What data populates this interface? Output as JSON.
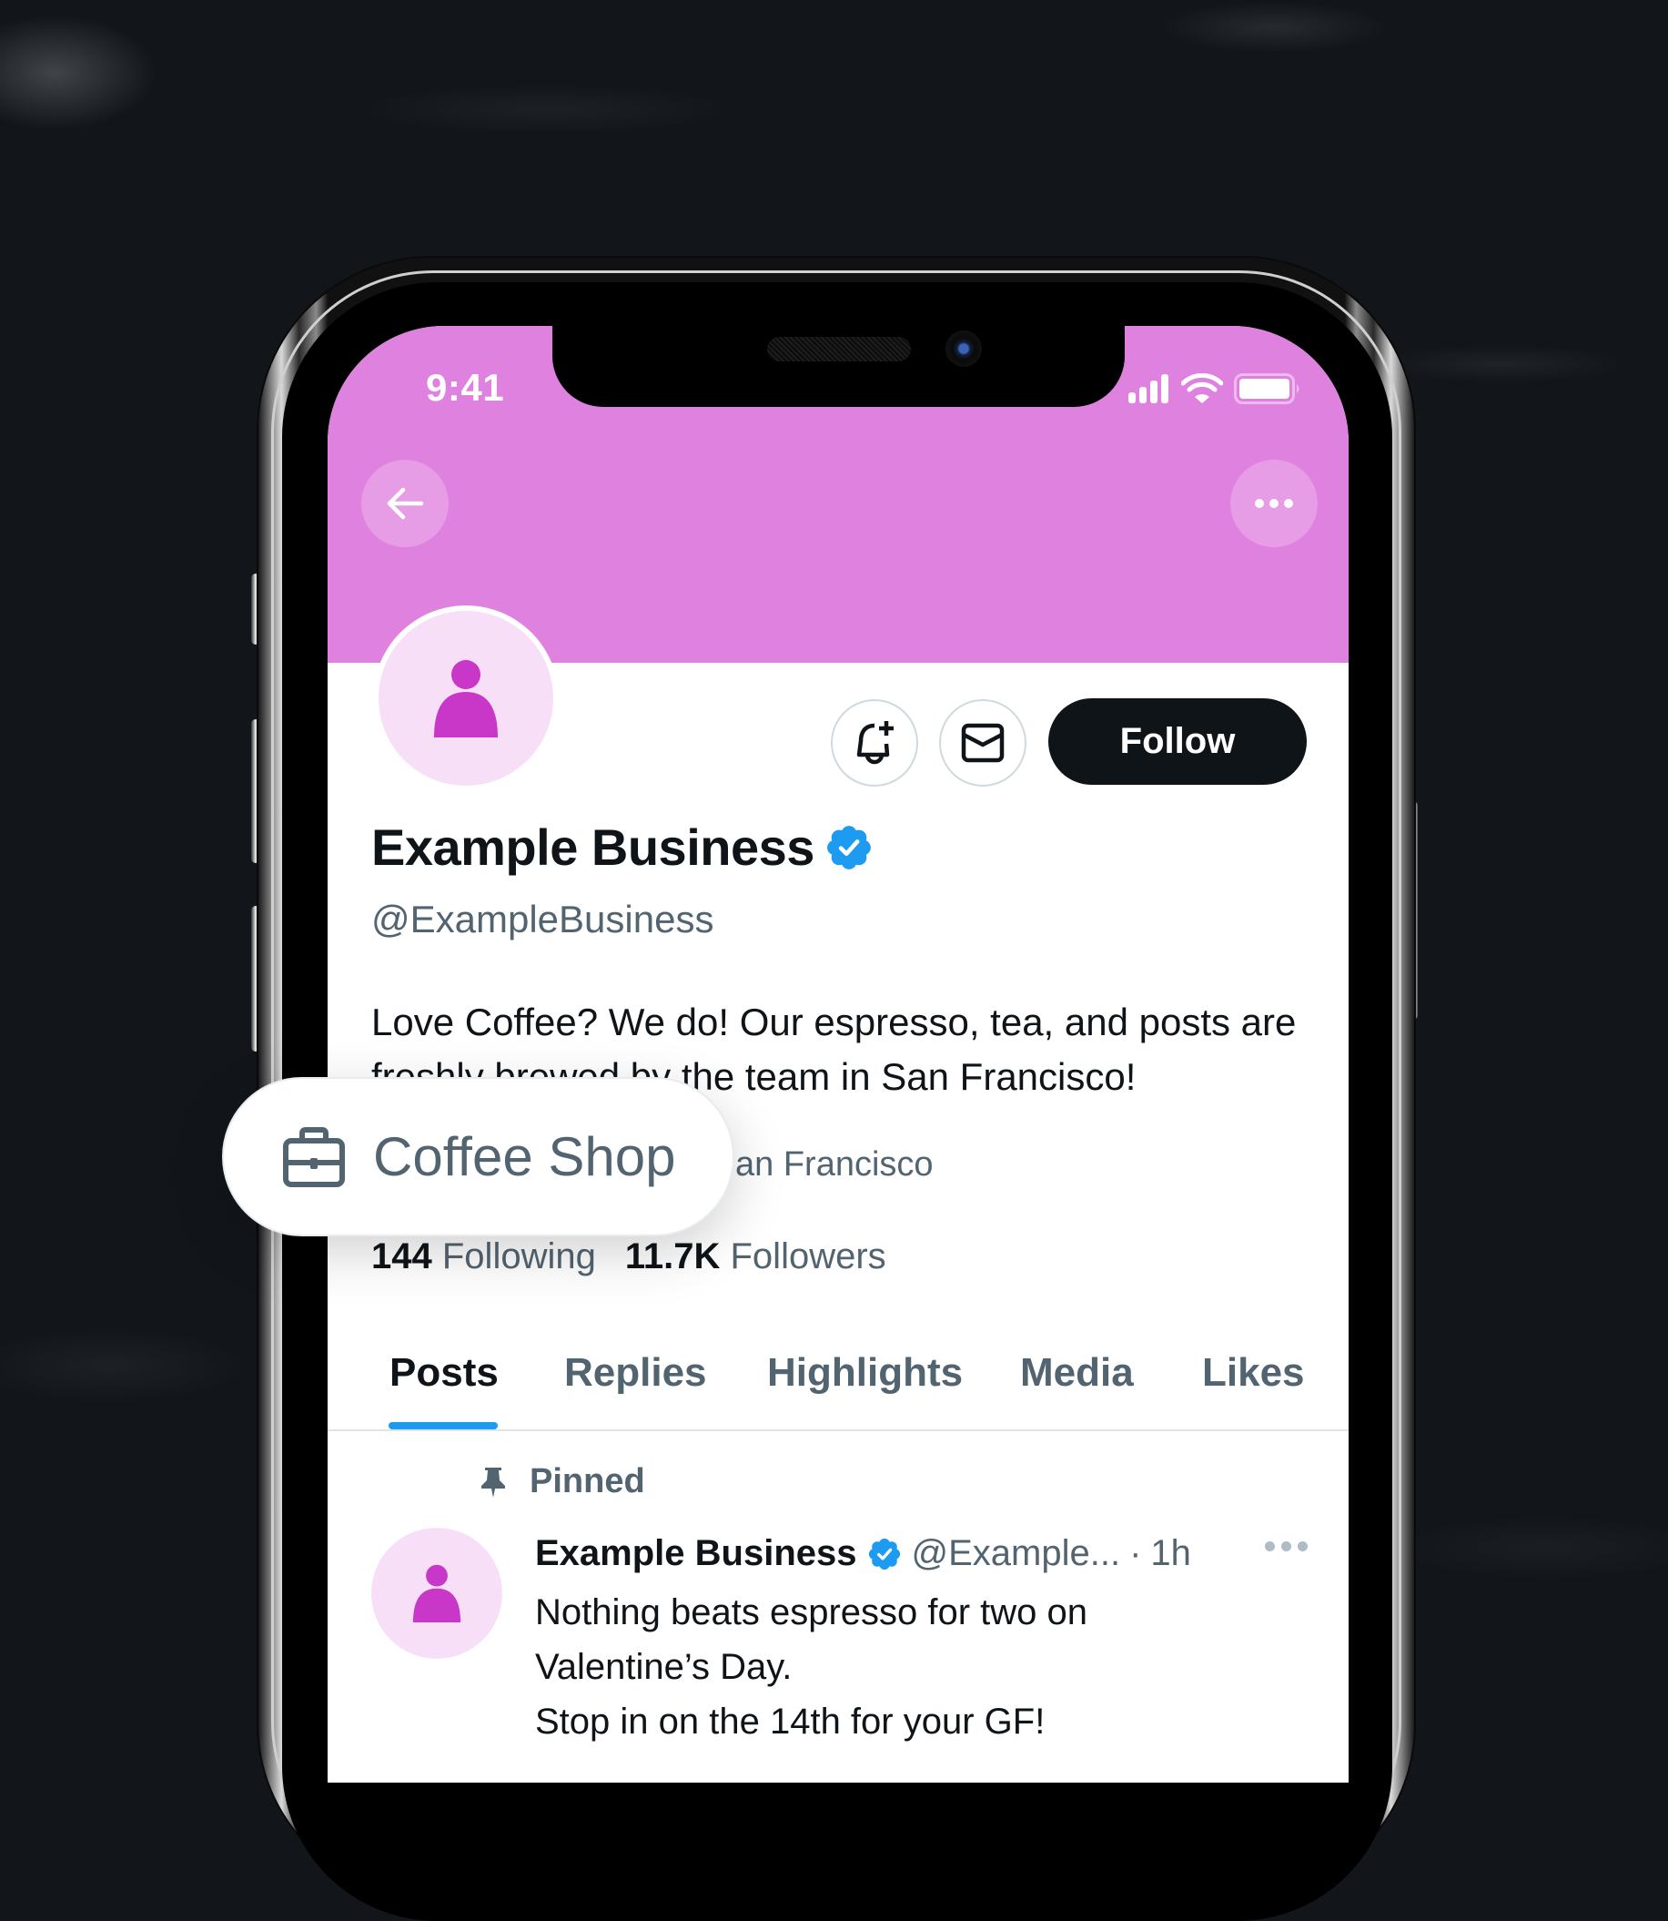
{
  "colors": {
    "banner": "#DF82DF",
    "avatar_bg": "#F8DFF8",
    "avatar_icon": "#C837C8",
    "primary_text": "#0F1419",
    "secondary_text": "#536471",
    "accent_blue": "#1D9BF0",
    "follow_bg": "#0F1419"
  },
  "status_bar": {
    "time": "9:41",
    "icons": [
      "cellular-signal-icon",
      "wifi-icon",
      "battery-icon"
    ]
  },
  "header": {
    "back_icon": "arrow-left-icon",
    "more_icon": "more-horizontal-icon"
  },
  "profile": {
    "display_name": "Example Business",
    "verified": true,
    "handle": "@ExampleBusiness",
    "bio": "Love Coffee? We do! Our espresso, tea, and posts are freshly brewed by the team in San Francisco!",
    "location_visible": "an Francisco",
    "following_count": "144",
    "following_label": "Following",
    "followers_count": "11.7K",
    "followers_label": "Followers"
  },
  "actions": {
    "notify_icon": "bell-plus-icon",
    "message_icon": "mail-icon",
    "follow_label": "Follow"
  },
  "category_chip": {
    "icon": "briefcase-icon",
    "label": "Coffee Shop"
  },
  "tabs": [
    {
      "label": "Posts",
      "active": true
    },
    {
      "label": "Replies",
      "active": false
    },
    {
      "label": "Highlights",
      "active": false
    },
    {
      "label": "Media",
      "active": false
    },
    {
      "label": "Likes",
      "active": false
    }
  ],
  "pinned_post": {
    "pinned_label": "Pinned",
    "author_name": "Example Business",
    "author_handle": "@Example...",
    "separator": "·",
    "time": "1h",
    "text_lines": [
      "Nothing beats espresso for two on",
      "Valentine’s Day.",
      "Stop in on the 14th for your GF!"
    ]
  }
}
